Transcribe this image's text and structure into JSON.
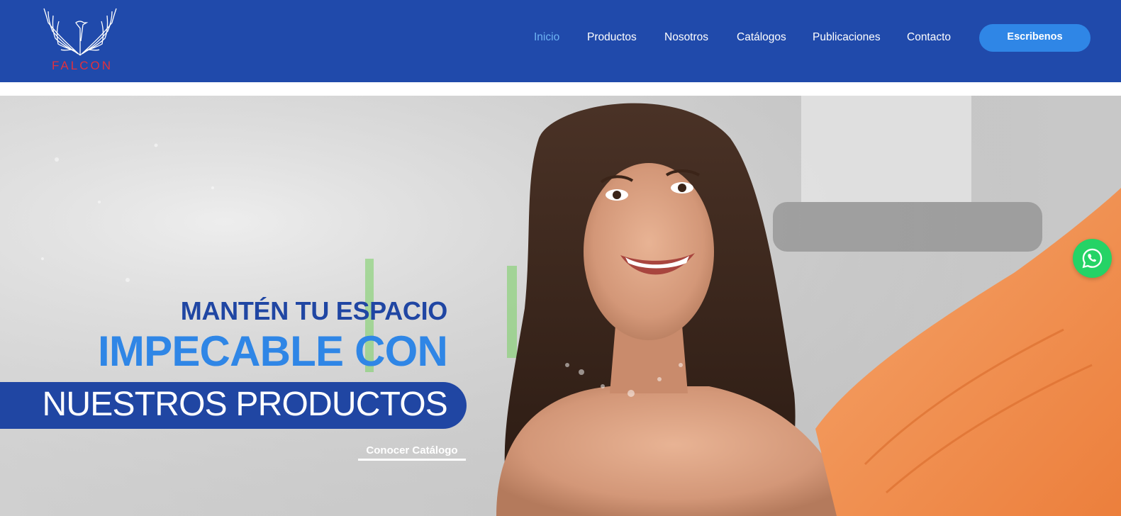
{
  "brand": {
    "name": "FALCON",
    "accent": "#204aab",
    "logo_text_color": "#e2303d"
  },
  "nav": {
    "items": [
      {
        "label": "Inicio",
        "active": true
      },
      {
        "label": "Productos"
      },
      {
        "label": "Nosotros"
      },
      {
        "label": "Catálogos"
      },
      {
        "label": "Publicaciones"
      },
      {
        "label": "Contacto"
      }
    ],
    "cta_label": "Escribenos"
  },
  "hero": {
    "line1": "MANTÉN TU ESPACIO",
    "line2": "IMPECABLE CON",
    "line3": "NUESTROS PRODUCTOS",
    "link_label": "Conocer Catálogo",
    "image": "woman-cleaning-glass-photo"
  },
  "floating": {
    "icon": "whatsapp-icon",
    "color": "#25d366"
  }
}
